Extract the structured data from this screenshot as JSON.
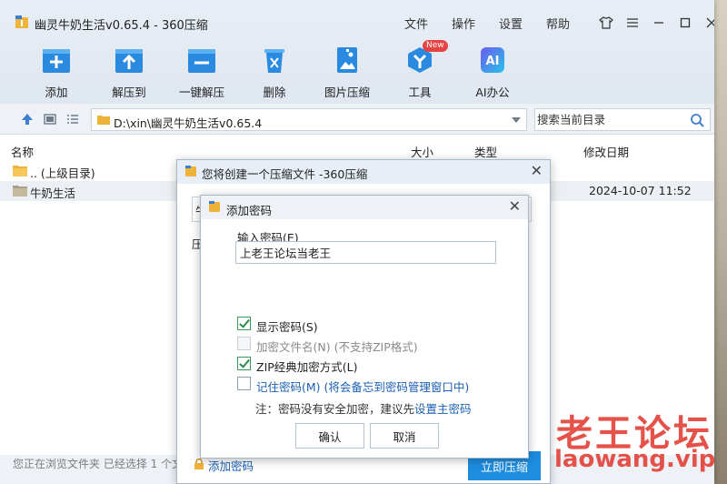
{
  "window": {
    "title": "幽灵牛奶生活v0.65.4 - 360压缩"
  },
  "menu": [
    "文件",
    "操作",
    "设置",
    "帮助"
  ],
  "toolbar": [
    {
      "label": "添加",
      "icon": "add-icon"
    },
    {
      "label": "解压到",
      "icon": "extract-to-icon"
    },
    {
      "label": "一键解压",
      "icon": "one-click-extract-icon"
    },
    {
      "label": "删除",
      "icon": "delete-icon"
    },
    {
      "label": "图片压缩",
      "icon": "image-compress-icon"
    },
    {
      "label": "工具",
      "icon": "tools-icon",
      "badge": "New"
    },
    {
      "label": "AI办公",
      "icon": "ai-office-icon",
      "glyph": "AI"
    }
  ],
  "address": {
    "path": "D:\\xin\\幽灵牛奶生活v0.65.4"
  },
  "search": {
    "placeholder": "搜索当前目录"
  },
  "list": {
    "columns": {
      "name": "名称",
      "size": "大小",
      "type": "类型",
      "modified": "修改日期"
    },
    "rows": [
      {
        "name": ".. (上级目录)",
        "modified": ""
      },
      {
        "name": "牛奶生活",
        "modified": "2024-10-07 11:52"
      }
    ]
  },
  "status": {
    "text": "您正在浏览文件夹 已经选择 1 个文"
  },
  "create_dialog": {
    "title": "您将创建一个压缩文件 -360压缩",
    "name_fragment": "牛",
    "label_fragment": "压",
    "add_password_link": "添加密码",
    "start_button": "立即压缩"
  },
  "password_dialog": {
    "title": "添加密码",
    "input_label": "输入密码(E)",
    "password_value": "上老王论坛当老王",
    "options": [
      {
        "label": "显示密码(S)",
        "checked": true,
        "enabled": true
      },
      {
        "label": "加密文件名(N) (不支持ZIP格式)",
        "checked": false,
        "enabled": false
      },
      {
        "label": "ZIP经典加密方式(L)",
        "checked": true,
        "enabled": true
      },
      {
        "label": "记住密码(M) (将会备忘到密码管理窗口中)",
        "checked": false,
        "enabled": true
      }
    ],
    "note_prefix": "注：密码没有安全加密，建议先",
    "note_link": "设置主密码",
    "ok_button": "确认",
    "cancel_button": "取消"
  },
  "watermark": {
    "line1": "老王论坛",
    "line2": "laowang.vip"
  },
  "colors": {
    "accent": "#1e8de0",
    "link": "#1a5fb4",
    "watermark": "#e23b32"
  }
}
